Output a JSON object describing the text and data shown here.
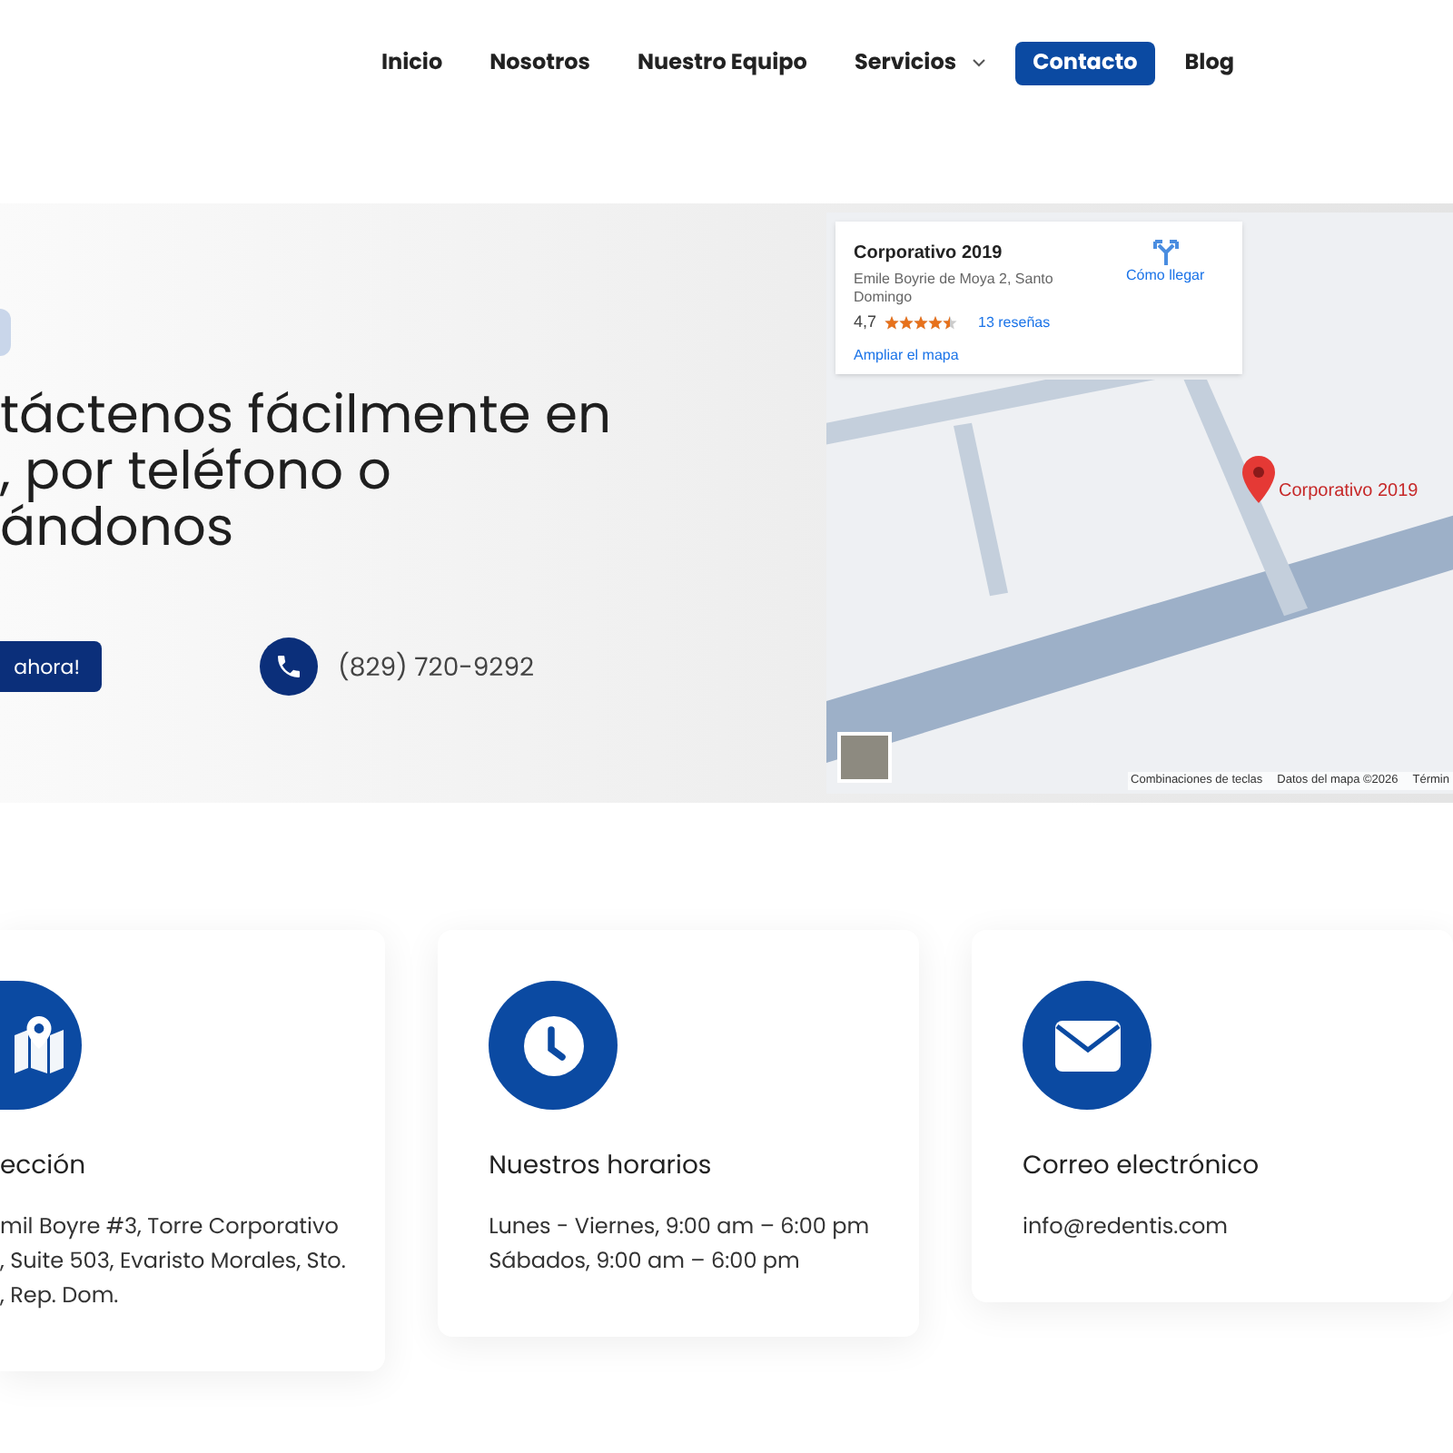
{
  "nav": {
    "items": [
      {
        "label": "Inicio",
        "selected": false,
        "dropdown": false
      },
      {
        "label": "Nosotros",
        "selected": false,
        "dropdown": false
      },
      {
        "label": "Nuestro Equipo",
        "selected": false,
        "dropdown": false
      },
      {
        "label": "Servicios",
        "selected": false,
        "dropdown": true
      },
      {
        "label": "Contacto",
        "selected": true,
        "dropdown": false
      },
      {
        "label": "Blog",
        "selected": false,
        "dropdown": false
      }
    ]
  },
  "hero": {
    "heading_lines": [
      "táctenos fácilmente en",
      ", por teléfono o",
      "ándonos"
    ],
    "button": "ahora!",
    "phone": "(829) 720-9292"
  },
  "map": {
    "place_name": "Corporativo 2019",
    "address": "Emile Boyrie de Moya 2, Santo Domingo",
    "rating": "4,7",
    "stars": 4.5,
    "reviews": "13 reseñas",
    "enlarge": "Ampliar el mapa",
    "directions": "Cómo llegar",
    "pin_label": "Corporativo 2019",
    "footer": [
      "Combinaciones de teclas",
      "Datos del mapa ©2026",
      "Términ"
    ]
  },
  "cards": [
    {
      "kind": "map",
      "title": "ección",
      "lines": [
        "mil Boyre #3, Torre Corporativo",
        ", Suite 503, Evaristo Morales, Sto.",
        ", Rep. Dom."
      ]
    },
    {
      "kind": "clock",
      "title": "Nuestros horarios",
      "lines": [
        "Lunes - Viernes, 9:00 am – 6:00 pm",
        "Sábados, 9:00 am – 6:00 pm"
      ]
    },
    {
      "kind": "mail",
      "title": "Correo electrónico",
      "lines": [
        "info@redentis.com"
      ]
    }
  ]
}
